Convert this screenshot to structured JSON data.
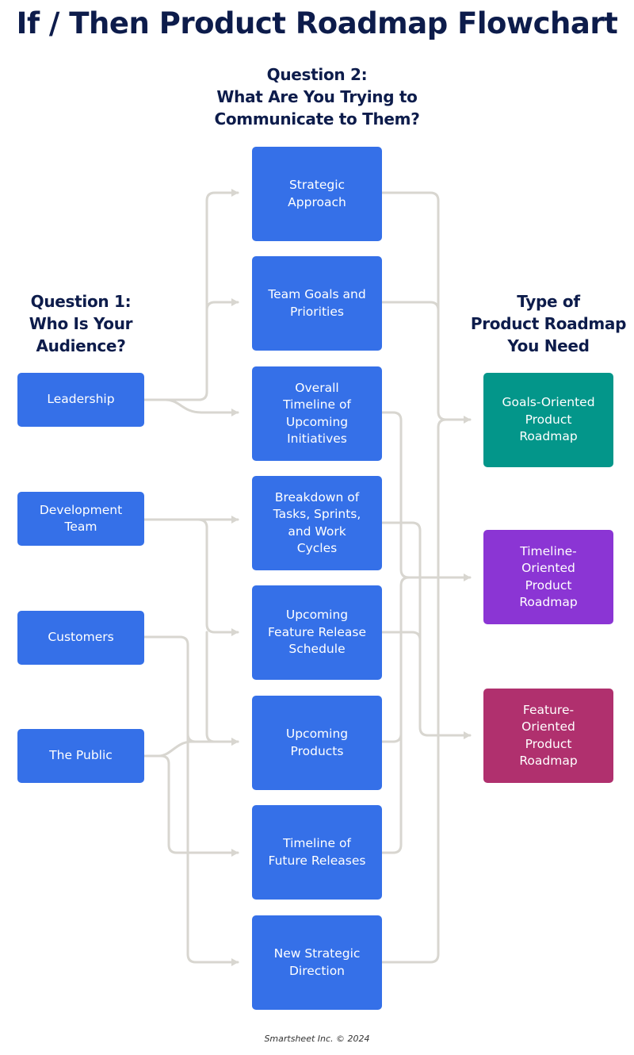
{
  "title": "If / Then Product Roadmap Flowchart",
  "headings": {
    "question2": [
      "Question 2:",
      "What Are You Trying to",
      "Communicate to Them?"
    ],
    "question1": [
      "Question 1:",
      "Who Is Your",
      "Audience?"
    ],
    "roadmap_type": [
      "Type of",
      "Product Roadmap",
      "You Need"
    ]
  },
  "audiences": [
    {
      "id": "leadership",
      "lines": [
        "Leadership"
      ]
    },
    {
      "id": "development-team",
      "lines": [
        "Development",
        "Team"
      ]
    },
    {
      "id": "customers",
      "lines": [
        "Customers"
      ]
    },
    {
      "id": "the-public",
      "lines": [
        "The Public"
      ]
    }
  ],
  "messages": [
    {
      "id": "strategic-approach",
      "lines": [
        "Strategic",
        "Approach"
      ]
    },
    {
      "id": "team-goals",
      "lines": [
        "Team Goals and",
        "Priorities"
      ]
    },
    {
      "id": "overall-timeline",
      "lines": [
        "Overall",
        "Timeline of",
        "Upcoming",
        "Initiatives"
      ]
    },
    {
      "id": "breakdown",
      "lines": [
        "Breakdown of",
        "Tasks, Sprints,",
        "and Work",
        "Cycles"
      ]
    },
    {
      "id": "feature-release",
      "lines": [
        "Upcoming",
        "Feature Release",
        "Schedule"
      ]
    },
    {
      "id": "upcoming-products",
      "lines": [
        "Upcoming",
        "Products"
      ]
    },
    {
      "id": "future-releases",
      "lines": [
        "Timeline of",
        "Future Releases"
      ]
    },
    {
      "id": "new-direction",
      "lines": [
        "New Strategic",
        "Direction"
      ]
    }
  ],
  "roadmap_types": [
    {
      "id": "goals-oriented",
      "lines": [
        "Goals-Oriented",
        "Product",
        "Roadmap"
      ],
      "color": "#03968a"
    },
    {
      "id": "timeline-oriented",
      "lines": [
        "Timeline-",
        "Oriented",
        "Product",
        "Roadmap"
      ],
      "color": "#8b35d4"
    },
    {
      "id": "feature-oriented",
      "lines": [
        "Feature-",
        "Oriented",
        "Product",
        "Roadmap"
      ],
      "color": "#b0306e"
    }
  ],
  "colors": {
    "heading": "#0d1c4b",
    "box_blue": "#3570e8",
    "connector": "#d8d6d0"
  },
  "links_audience_to_message": [
    [
      "leadership",
      "strategic-approach"
    ],
    [
      "leadership",
      "team-goals"
    ],
    [
      "leadership",
      "overall-timeline"
    ],
    [
      "development-team",
      "breakdown"
    ],
    [
      "development-team",
      "feature-release"
    ],
    [
      "development-team",
      "upcoming-products"
    ],
    [
      "customers",
      "upcoming-products"
    ],
    [
      "customers",
      "new-direction"
    ],
    [
      "the-public",
      "upcoming-products"
    ],
    [
      "the-public",
      "future-releases"
    ]
  ],
  "links_message_to_type": [
    [
      "strategic-approach",
      "goals-oriented"
    ],
    [
      "team-goals",
      "goals-oriented"
    ],
    [
      "new-direction",
      "goals-oriented"
    ],
    [
      "overall-timeline",
      "timeline-oriented"
    ],
    [
      "upcoming-products",
      "timeline-oriented"
    ],
    [
      "future-releases",
      "timeline-oriented"
    ],
    [
      "breakdown",
      "feature-oriented"
    ],
    [
      "feature-release",
      "feature-oriented"
    ]
  ],
  "footer": "Smartsheet Inc. © 2024"
}
